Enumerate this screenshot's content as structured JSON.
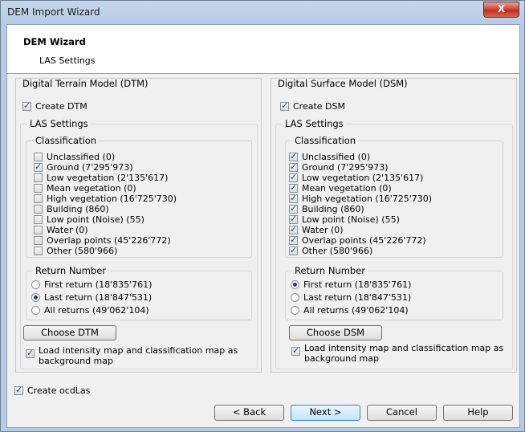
{
  "window": {
    "title": "DEM Import Wizard",
    "close_label": "X"
  },
  "header": {
    "title": "DEM Wizard",
    "subtitle": "LAS Settings"
  },
  "dtm": {
    "panel_title": "Digital Terrain Model (DTM)",
    "create_label": "Create DTM",
    "las_settings_label": "LAS Settings",
    "classification_label": "Classification",
    "classes": [
      {
        "label": "Unclassified  (0)",
        "checked": false
      },
      {
        "label": "Ground (7'295'973)",
        "checked": true
      },
      {
        "label": "Low vegetation (2'135'617)",
        "checked": false
      },
      {
        "label": "Mean vegetation (0)",
        "checked": false
      },
      {
        "label": "High vegetation (16'725'730)",
        "checked": false
      },
      {
        "label": "Building (860)",
        "checked": false
      },
      {
        "label": "Low point (Noise) (55)",
        "checked": false
      },
      {
        "label": "Water (0)",
        "checked": false
      },
      {
        "label": "Overlap points (45'226'772)",
        "checked": false
      },
      {
        "label": "Other (580'966)",
        "checked": false
      }
    ],
    "return_label": "Return Number",
    "returns": [
      {
        "label": "First return (18'835'761)",
        "selected": false
      },
      {
        "label": "Last return (18'847'531)",
        "selected": true
      },
      {
        "label": "All returns (49'062'104)",
        "selected": false
      }
    ],
    "choose_label": "Choose DTM",
    "load_map_label_1": "Load intensity map and classification map as",
    "load_map_label_2": "background map"
  },
  "dsm": {
    "panel_title": "Digital Surface Model (DSM)",
    "create_label": "Create DSM",
    "las_settings_label": "LAS Settings",
    "classification_label": "Classification",
    "classes": [
      {
        "label": "Unclassified  (0)",
        "checked": true
      },
      {
        "label": "Ground (7'295'973)",
        "checked": true
      },
      {
        "label": "Low vegetation (2'135'617)",
        "checked": true
      },
      {
        "label": "Mean vegetation (0)",
        "checked": true
      },
      {
        "label": "High vegetation (16'725'730)",
        "checked": true
      },
      {
        "label": "Building (860)",
        "checked": true
      },
      {
        "label": "Low point (Noise) (55)",
        "checked": true
      },
      {
        "label": "Water (0)",
        "checked": true
      },
      {
        "label": "Overlap points (45'226'772)",
        "checked": true
      },
      {
        "label": "Other (580'966)",
        "checked": true
      }
    ],
    "return_label": "Return Number",
    "returns": [
      {
        "label": "First return (18'835'761)",
        "selected": true
      },
      {
        "label": "Last return (18'847'531)",
        "selected": false
      },
      {
        "label": "All returns (49'062'104)",
        "selected": false
      }
    ],
    "choose_label": "Choose DSM",
    "load_map_label_1": "Load intensity map and classification map as",
    "load_map_label_2": "background map"
  },
  "footer": {
    "create_ocdlas_label": "Create ocdLas",
    "back_label": "< Back",
    "next_label": "Next >",
    "cancel_label": "Cancel",
    "help_label": "Help"
  }
}
